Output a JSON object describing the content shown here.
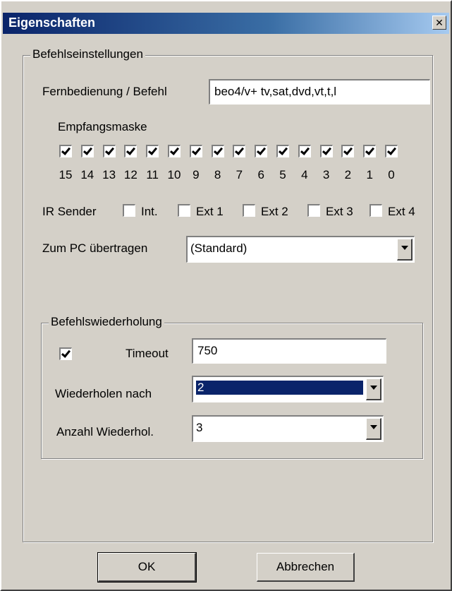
{
  "window": {
    "title": "Eigenschaften",
    "close_icon": "close-icon"
  },
  "command_group": {
    "legend": "Befehlseinstellungen",
    "remote_label": "Fernbedienung / Befehl",
    "remote_value": "beo4/v+ tv,sat,dvd,vt,t,l",
    "mask_label": "Empfangsmaske",
    "mask_bits": [
      {
        "label": "15",
        "checked": true
      },
      {
        "label": "14",
        "checked": true
      },
      {
        "label": "13",
        "checked": true
      },
      {
        "label": "12",
        "checked": true
      },
      {
        "label": "11",
        "checked": true
      },
      {
        "label": "10",
        "checked": true
      },
      {
        "label": "9",
        "checked": true
      },
      {
        "label": "8",
        "checked": true
      },
      {
        "label": "7",
        "checked": true
      },
      {
        "label": "6",
        "checked": true
      },
      {
        "label": "5",
        "checked": true
      },
      {
        "label": "4",
        "checked": true
      },
      {
        "label": "3",
        "checked": true
      },
      {
        "label": "2",
        "checked": true
      },
      {
        "label": "1",
        "checked": true
      },
      {
        "label": "0",
        "checked": true
      }
    ],
    "ir_label": "IR Sender",
    "ir_options": [
      {
        "label": "Int.",
        "checked": false
      },
      {
        "label": "Ext 1",
        "checked": false
      },
      {
        "label": "Ext 2",
        "checked": false
      },
      {
        "label": "Ext 3",
        "checked": false
      },
      {
        "label": "Ext 4",
        "checked": false
      }
    ],
    "pc_label": "Zum PC übertragen",
    "pc_value": "(Standard)"
  },
  "repeat_group": {
    "legend": "Befehlswiederholung",
    "timeout_checked": true,
    "timeout_label": "Timeout",
    "timeout_value": "750",
    "repeat_after_label": "Wiederholen nach",
    "repeat_after_value": "2",
    "count_label": "Anzahl Wiederhol.",
    "count_value": "3"
  },
  "buttons": {
    "ok": "OK",
    "cancel": "Abbrechen"
  }
}
